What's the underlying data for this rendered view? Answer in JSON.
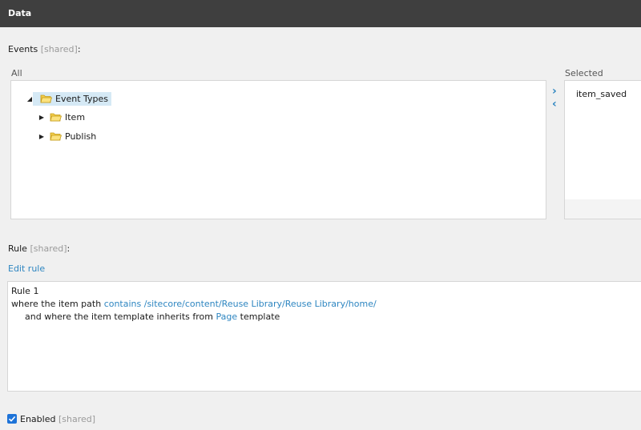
{
  "header": {
    "title": "Data"
  },
  "events": {
    "label": "Events",
    "shared": "[shared]",
    "colon": ":",
    "all_label": "All",
    "selected_label": "Selected",
    "tree": [
      {
        "label": "Event Types",
        "icon": "folder-icon",
        "expander": "expanded"
      },
      {
        "label": "Item",
        "icon": "folder-icon",
        "expander": "collapsed"
      },
      {
        "label": "Publish",
        "icon": "folder-icon",
        "expander": "collapsed"
      }
    ],
    "selected_items": [
      "item_saved"
    ],
    "add_arrow": "chevron-right-icon",
    "remove_arrow": "chevron-left-icon"
  },
  "rule": {
    "label": "Rule",
    "shared": "[shared]",
    "colon": ":",
    "edit_link": "Edit rule",
    "name": "Rule 1",
    "line1": {
      "prefix": "where the item path ",
      "op": "contains",
      "value": "/sitecore/content/Reuse Library/Reuse Library/home/"
    },
    "line2": {
      "prefix": "and where the item template inherits from ",
      "value": "Page",
      "suffix": " template"
    }
  },
  "enabled": {
    "label": "Enabled",
    "shared": "[shared]",
    "checked": true
  },
  "colors": {
    "header_bg": "#3f3f3f",
    "link": "#2e86c1",
    "selection_bg": "#d5e9f5",
    "checkbox": "#1e73d8"
  }
}
